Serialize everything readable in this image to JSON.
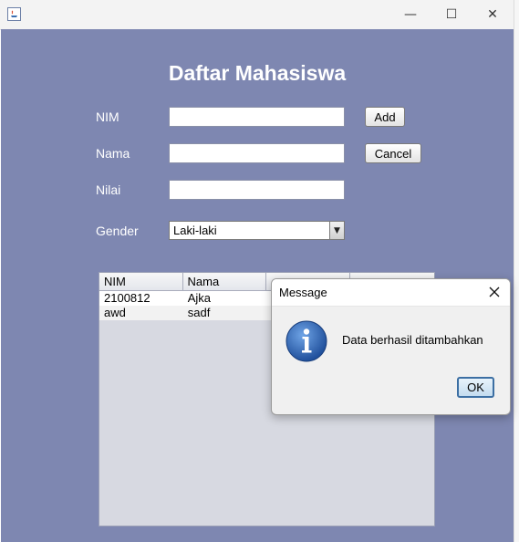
{
  "window": {
    "minimize_glyph": "—",
    "maximize_glyph": "☐",
    "close_glyph": "✕"
  },
  "form": {
    "title": "Daftar Mahasiswa",
    "nim_label": "NIM",
    "nama_label": "Nama",
    "nilai_label": "Nilai",
    "gender_label": "Gender",
    "nim_value": "",
    "nama_value": "",
    "nilai_value": "",
    "gender_selected": "Laki-laki",
    "add_label": "Add",
    "cancel_label": "Cancel"
  },
  "table": {
    "columns": [
      "NIM",
      "Nama",
      "",
      ""
    ],
    "rows": [
      [
        "2100812",
        "Ajka",
        "",
        ""
      ],
      [
        "awd",
        "sadf",
        "",
        ""
      ]
    ]
  },
  "dialog": {
    "title": "Message",
    "message": "Data berhasil ditambahkan",
    "ok_label": "OK",
    "icon": "info-icon"
  },
  "colors": {
    "background": "#7e87b1",
    "label_text": "#ffffff",
    "table_background": "#d7d9e1",
    "info_icon_blue": "#2d64b3"
  }
}
